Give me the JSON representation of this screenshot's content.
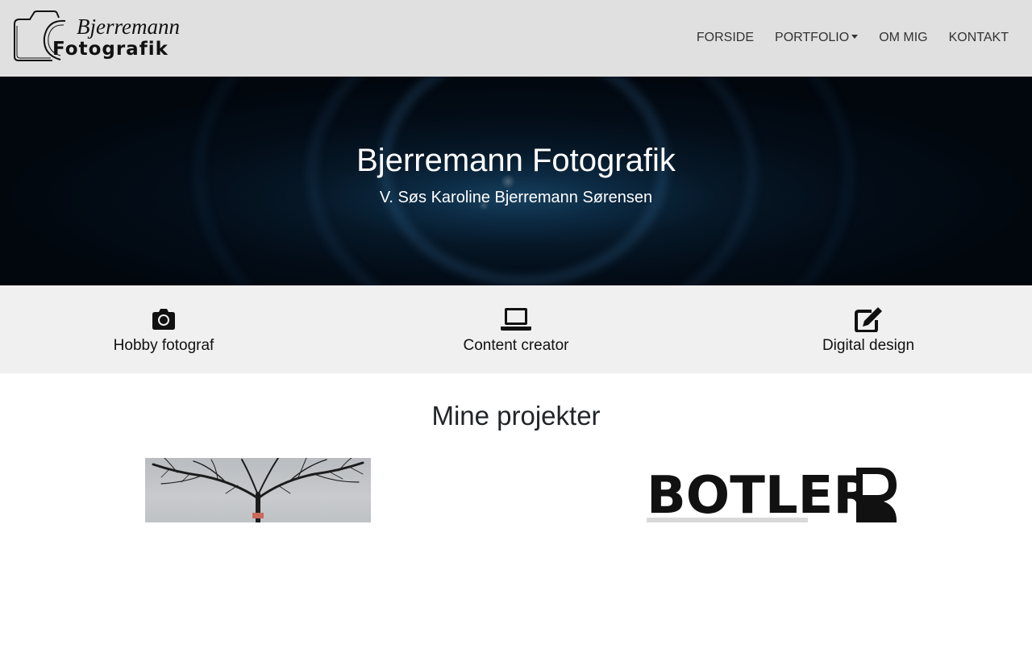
{
  "logo": {
    "script_text": "Bjerremann",
    "word_text": "Fotografik"
  },
  "nav": {
    "items": [
      {
        "label": "FORSIDE"
      },
      {
        "label": "PORTFOLIO",
        "dropdown": true
      },
      {
        "label": "OM MIG"
      },
      {
        "label": "KONTAKT"
      }
    ]
  },
  "hero": {
    "title": "Bjerremann Fotografik",
    "subtitle": "V. Søs Karoline Bjerremann Sørensen"
  },
  "features": [
    {
      "label": "Hobby fotograf",
      "icon": "camera-icon"
    },
    {
      "label": "Content creator",
      "icon": "laptop-icon"
    },
    {
      "label": "Digital design",
      "icon": "edit-icon"
    }
  ],
  "projects": {
    "title": "Mine projekter",
    "logo_text": "BOTLER"
  },
  "colors": {
    "navbar_bg": "#e0e0e0",
    "features_bg": "#f0f0f0",
    "hero_bg": "#0c2a43"
  }
}
